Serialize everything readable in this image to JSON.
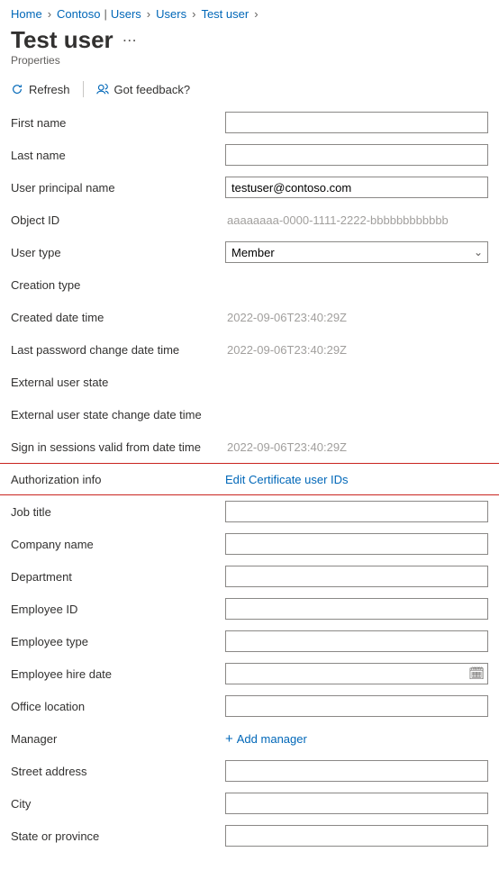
{
  "breadcrumb": {
    "home": "Home",
    "tenant": "Contoso",
    "sep_pipe": "|",
    "seg_users1": "Users",
    "seg_users2": "Users",
    "seg_user": "Test user"
  },
  "header": {
    "title": "Test user",
    "subtitle": "Properties"
  },
  "toolbar": {
    "refresh": "Refresh",
    "feedback": "Got feedback?"
  },
  "fields": {
    "first_name": {
      "label": "First name",
      "value": ""
    },
    "last_name": {
      "label": "Last name",
      "value": ""
    },
    "upn": {
      "label": "User principal name",
      "value": "testuser@contoso.com"
    },
    "object_id": {
      "label": "Object ID",
      "value": "aaaaaaaa-0000-1111-2222-bbbbbbbbbbbb"
    },
    "user_type": {
      "label": "User type",
      "value": "Member"
    },
    "creation_type": {
      "label": "Creation type"
    },
    "created_dt": {
      "label": "Created date time",
      "value": "2022-09-06T23:40:29Z"
    },
    "last_pwd_change": {
      "label": "Last password change date time",
      "value": "2022-09-06T23:40:29Z"
    },
    "ext_user_state": {
      "label": "External user state"
    },
    "ext_user_state_change": {
      "label": "External user state change date time"
    },
    "signin_valid_from": {
      "label": "Sign in sessions valid from date time",
      "value": "2022-09-06T23:40:29Z"
    },
    "auth_info": {
      "label": "Authorization info",
      "link": "Edit Certificate user IDs"
    },
    "job_title": {
      "label": "Job title",
      "value": ""
    },
    "company_name": {
      "label": "Company name",
      "value": ""
    },
    "department": {
      "label": "Department",
      "value": ""
    },
    "employee_id": {
      "label": "Employee ID",
      "value": ""
    },
    "employee_type": {
      "label": "Employee type",
      "value": ""
    },
    "employee_hire_date": {
      "label": "Employee hire date",
      "value": ""
    },
    "office_location": {
      "label": "Office location",
      "value": ""
    },
    "manager": {
      "label": "Manager",
      "link": "Add manager"
    },
    "street_address": {
      "label": "Street address",
      "value": ""
    },
    "city": {
      "label": "City",
      "value": ""
    },
    "state_province": {
      "label": "State or province",
      "value": ""
    }
  }
}
